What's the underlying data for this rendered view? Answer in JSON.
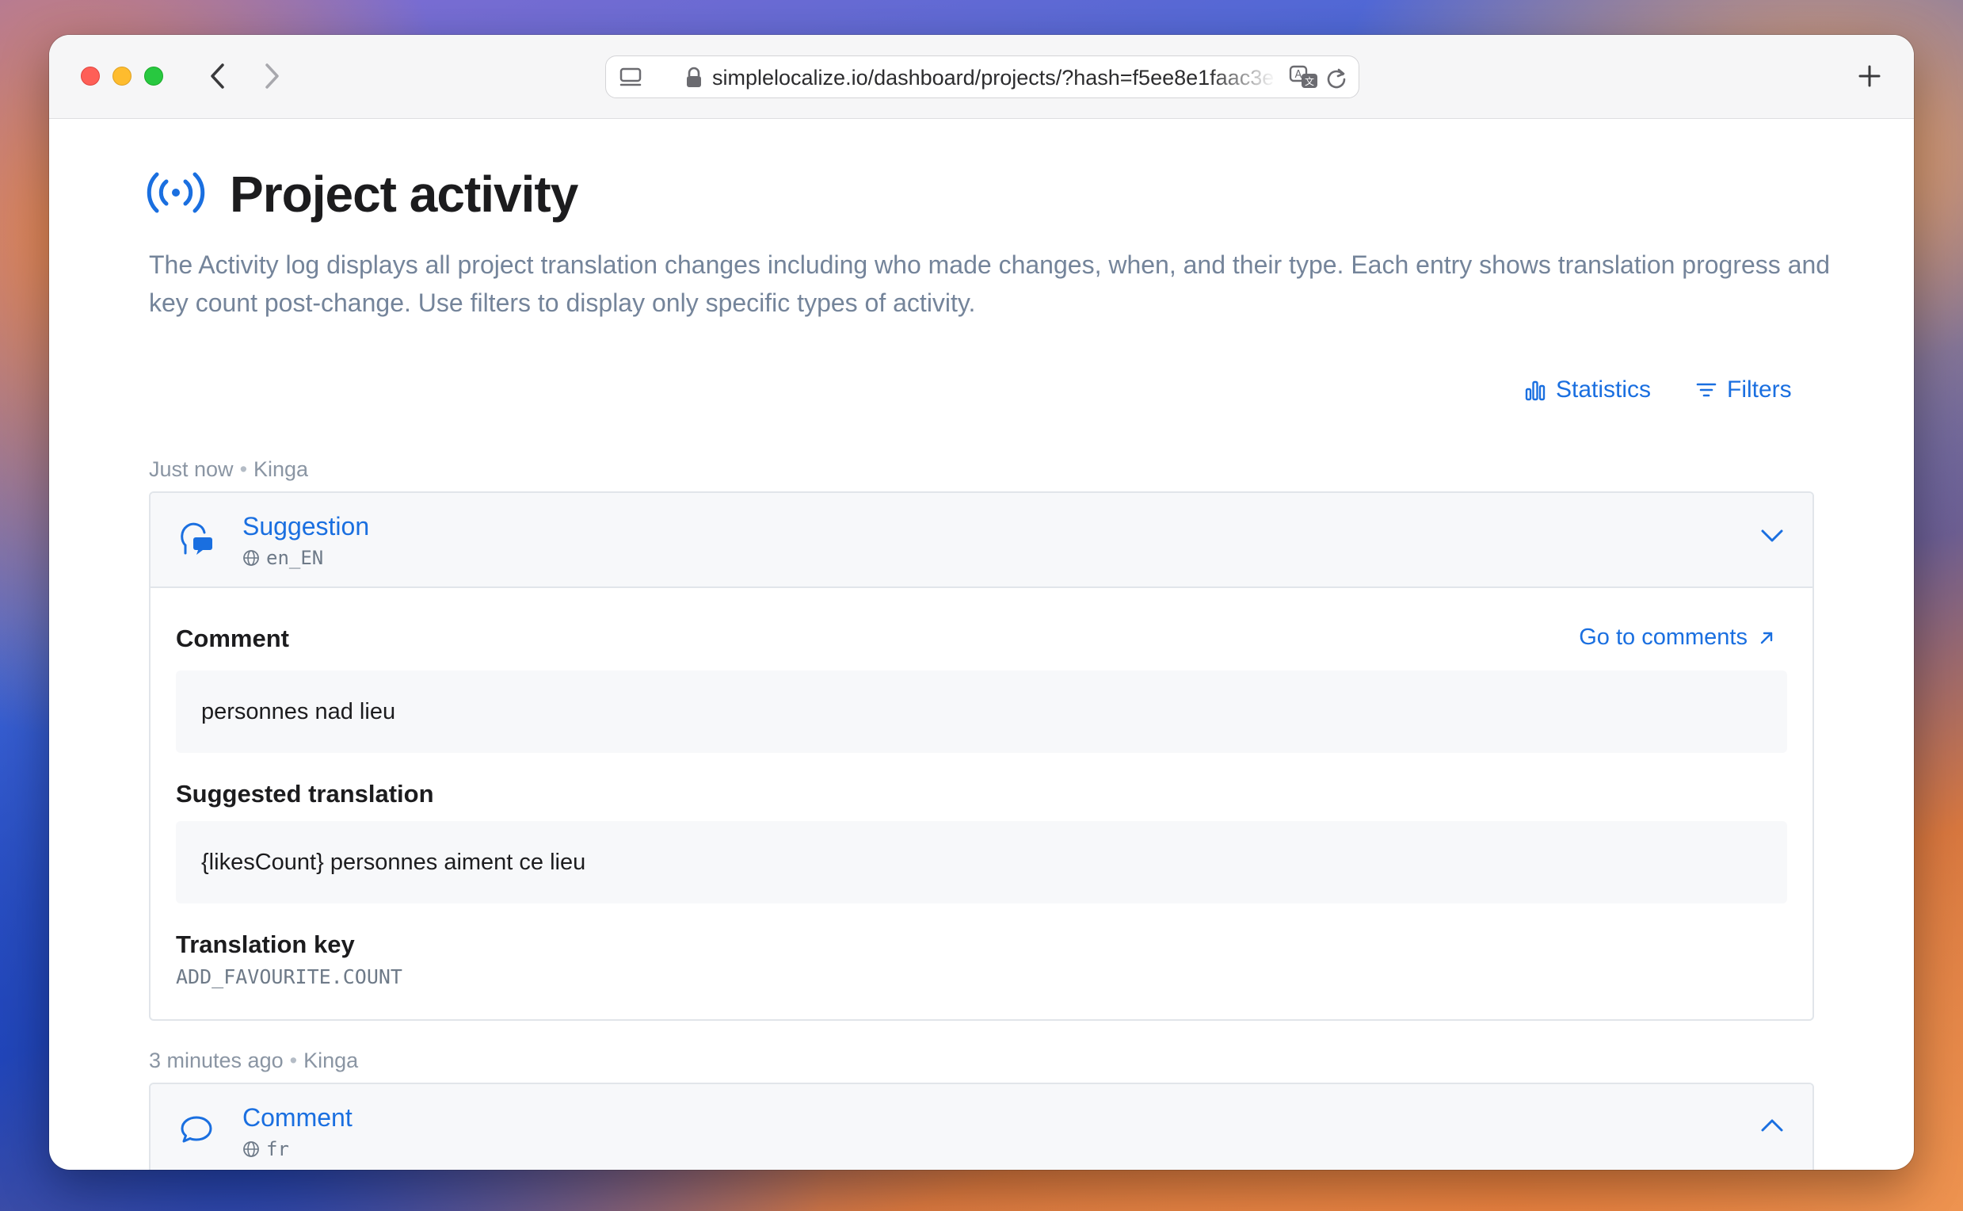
{
  "browser": {
    "url": "simplelocalize.io/dashboard/projects/?hash=f5ee8e1faac3e"
  },
  "page": {
    "title": "Project activity",
    "description": "The Activity log displays all project translation changes including who made changes, when, and their type. Each entry shows translation progress and key count post-change. Use filters to display only specific types of activity."
  },
  "actions": {
    "statistics": "Statistics",
    "filters": "Filters"
  },
  "activities": [
    {
      "time": "Just now",
      "user": "Kinga",
      "type": "Suggestion",
      "locale": "en_EN",
      "comment_label": "Comment",
      "go_to_comments": "Go to comments",
      "comment": "personnes nad lieu",
      "suggested_label": "Suggested translation",
      "suggested": "{likesCount} personnes aiment ce lieu",
      "key_label": "Translation key",
      "key": "ADD_FAVOURITE.COUNT"
    },
    {
      "time": "3 minutes ago",
      "user": "Kinga",
      "type": "Comment",
      "locale": "fr"
    }
  ],
  "separator": "•",
  "colors": {
    "accent": "#1a6fe0",
    "muted": "#74849a",
    "title": "#1c1c1e"
  }
}
